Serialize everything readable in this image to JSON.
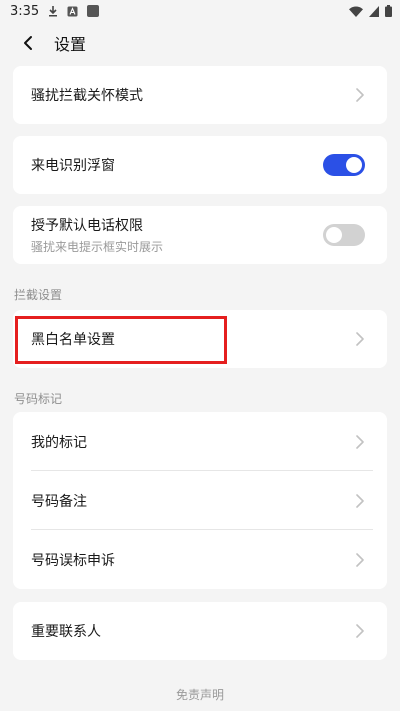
{
  "status_bar": {
    "time": "3:35",
    "icons": [
      "download-icon",
      "a-box-icon",
      "app-square-icon",
      "wifi-icon",
      "signal-icon",
      "battery-icon"
    ]
  },
  "header": {
    "back_icon": "chevron-left-icon",
    "title": "设置"
  },
  "general": {
    "items": [
      {
        "label": "骚扰拦截关怀模式",
        "control": "chevron"
      },
      {
        "label": "来电识别浮窗",
        "control": "toggle",
        "enabled": true
      },
      {
        "label": "授予默认电话权限",
        "sub": "骚扰来电提示框实时展示",
        "control": "toggle",
        "enabled": false
      }
    ]
  },
  "block_settings": {
    "title": "拦截设置",
    "items": [
      {
        "label": "黑白名单设置",
        "control": "chevron",
        "highlighted": true
      }
    ]
  },
  "number_mark": {
    "title": "号码标记",
    "items": [
      {
        "label": "我的标记",
        "control": "chevron"
      },
      {
        "label": "号码备注",
        "control": "chevron"
      },
      {
        "label": "号码误标申诉",
        "control": "chevron"
      }
    ]
  },
  "contacts": {
    "items": [
      {
        "label": "重要联系人",
        "control": "chevron"
      }
    ]
  },
  "footer": {
    "disclaimer": "免责声明"
  },
  "colors": {
    "toggle_on": "#2b50e6",
    "toggle_off": "#d2d2d2",
    "highlight": "#e51f1f",
    "background": "#f4f4f4"
  }
}
